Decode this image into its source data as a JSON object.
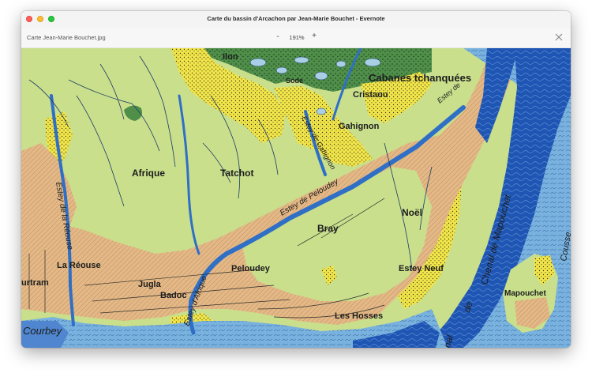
{
  "window": {
    "title": "Carte du bassin d'Arcachon par Jean-Marie Bouchet - Evernote"
  },
  "toolbar": {
    "filename": "Carte Jean-Marie Bouchet.jpg",
    "zoom_out": "-",
    "zoom_level": "191%",
    "zoom_in": "+"
  },
  "map": {
    "labels": {
      "ilon": "Ilon",
      "cabanes": "Cabanes tchanquées",
      "cristaou": "Cristaou",
      "gahignon": "Gahignon",
      "afrique": "Afrique",
      "tatchot": "Tatchot",
      "noel": "Noël",
      "bray": "Bray",
      "la_reouse": "La Réouse",
      "peloudey": "Peloudey",
      "jugla": "Jugla",
      "badoc": "Badoc",
      "urtram": "urtram",
      "estey_neuf": "Estey Neuf",
      "mapouchet": "Mapouchet",
      "les_hosses": "Les Hosses",
      "courbey": "Courbey",
      "estey_la_reouse": "Estey de la Réouse",
      "estey_peloudey": "Estey de Peloudey",
      "estey_afrique": "Estey d'Afrique",
      "estey_gahignon": "Estey de Gahignon",
      "chenal_mapouchet": "Chenal de Mapouchet",
      "cousse": "Cousse",
      "sode": "Sode",
      "nal": "nal",
      "de": "de",
      "estey_short": "Estey de"
    }
  },
  "colors": {
    "land": "#c9df8c",
    "marsh": "#4f8f4a",
    "sand": "#f2e64a",
    "cultivated": "#e3b886",
    "channel": "#2f6fc6",
    "shallow": "#79b2de",
    "deep": "#1f56b4"
  }
}
